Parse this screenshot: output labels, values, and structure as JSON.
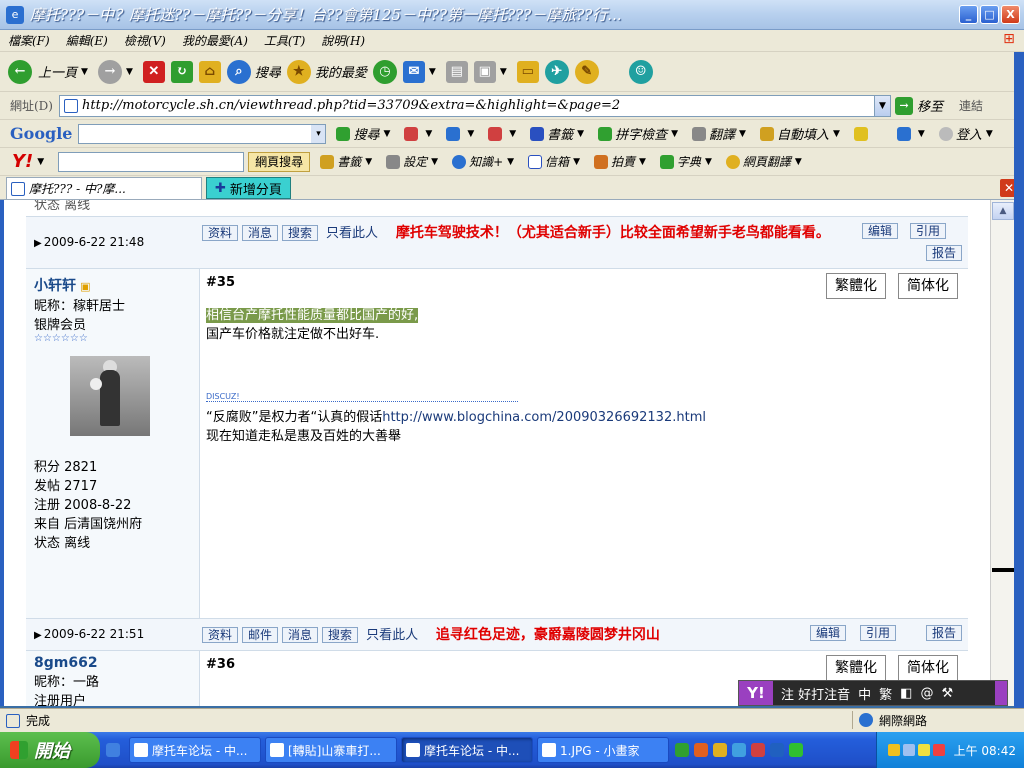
{
  "window": {
    "title": "摩托???－中？摩托迷??－摩托??－分享！台??會第125－中??第一摩托???－摩旅??行...",
    "buttons": {
      "min": "_",
      "max": "□",
      "close": "X"
    }
  },
  "menu": [
    "檔案(F)",
    "編輯(E)",
    "檢視(V)",
    "我的最愛(A)",
    "工具(T)",
    "說明(H)"
  ],
  "toolbar": {
    "back": "上一頁",
    "search": "搜尋",
    "favorites": "我的最愛"
  },
  "address": {
    "label": "網址(D)",
    "url": "http://motorcycle.sh.cn/viewthread.php?tid=33709&extra=&highlight=&page=2",
    "go": "移至",
    "links": "連結"
  },
  "google": {
    "logo": "Google",
    "search": "搜尋",
    "bookmarks": "書籤",
    "spellcheck": "拼字檢查",
    "translate": "翻譯",
    "autofill": "自動填入",
    "login": "登入"
  },
  "yahoo": {
    "search_btn": "網頁搜尋",
    "bookmarks": "書籤",
    "settings": "設定",
    "knowledge": "知識+",
    "mail": "信箱",
    "auction": "拍賣",
    "dictionary": "字典",
    "translate": "網頁翻譯"
  },
  "tabs": {
    "active": "摩托??? - 中?摩...",
    "new_tab": "新增分頁"
  },
  "posts": [
    {
      "date": "2009-6-22 21:48",
      "actions": [
        "资料",
        "消息",
        "搜索"
      ],
      "only_him": "只看此人",
      "signature_title": "摩托车驾驶技术！（尤其适合新手）比较全面希望新手老鸟都能看看。",
      "right_actions": [
        "编辑",
        "引用"
      ],
      "report": "报告",
      "prev_status": "状态 离线"
    },
    {
      "user": {
        "name": "小轩轩",
        "nickname": "昵称：稼軒居士",
        "group": "银牌会员",
        "stars": "☆☆☆☆☆☆",
        "points": "积分 2821",
        "posts": "发帖 2717",
        "registered": "注册 2008-8-22",
        "from": "来自 后清国饶州府",
        "status": "状态 离线"
      },
      "floor": "#35",
      "convert": [
        "繁體化",
        "简体化"
      ],
      "line_highlight": "相信台产摩托性能质量都比国产的好,",
      "line2": "国产车价格就注定做不出好车.",
      "sig_marker": "DISCUZ!",
      "sig_line1_a": "“反腐败”是权力者“认真的假话",
      "sig_line1_link": "http://www.blogchina.com/20090326692132.html",
      "sig_line2": "现在知道走私是惠及百姓的大善舉",
      "date": "2009-6-22 21:51",
      "actions": [
        "资料",
        "邮件",
        "消息",
        "搜索"
      ],
      "only_him": "只看此人",
      "signature_title": "追寻红色足迹，豪爵嘉陵圆梦井冈山",
      "right_actions": [
        "编辑",
        "引用"
      ],
      "report": "报告"
    },
    {
      "user": {
        "name": "8gm662",
        "nickname": "昵称：一路",
        "group": "注册用户"
      },
      "floor": "#36",
      "convert": [
        "繁體化",
        "简体化"
      ]
    }
  ],
  "ime": {
    "logo": "Y!",
    "text": "注 好打注音",
    "mode1": "中",
    "mode2": "繁"
  },
  "status": {
    "text": "完成",
    "zone": "網際網路"
  },
  "taskbar": {
    "start": "開始",
    "items": [
      "摩托车论坛 - 中...",
      "[轉貼]山寨車打...",
      "摩托车论坛 - 中...",
      "1.JPG - 小畫家"
    ],
    "clock": "上午 08:42"
  },
  "colors": {
    "accent": "#2a60c0",
    "alert": "#e00000",
    "link": "#1a3a7a"
  }
}
